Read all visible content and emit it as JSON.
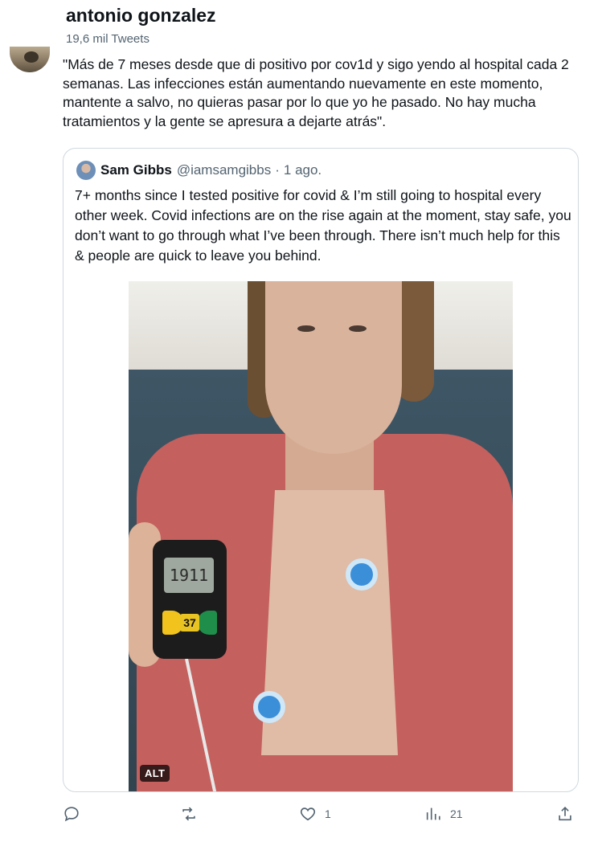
{
  "header": {
    "display_name": "antonio gonzalez",
    "tweet_count": "19,6 mil Tweets"
  },
  "tweet": {
    "text": "\"Más de 7 meses desde que di positivo por cov1d y sigo yendo al hospital cada 2 semanas. Las infecciones están aumentando nuevamente en este momento, mantente a salvo, no quieras pasar por lo que yo he pasado. No hay mucha tratamientos y la gente se apresura a dejarte atrás\"."
  },
  "quote": {
    "name": "Sam Gibbs",
    "handle": "@iamsamgibbs",
    "separator": "·",
    "time": "1 ago.",
    "text": "7+ months since I tested positive for covid & I’m still going to hospital every other week. Covid infections are on the rise again at the moment, stay safe, you don’t want to go through what I’ve been through. There isn’t much help for this & people are quick to leave you behind.",
    "image": {
      "alt_label": "ALT",
      "device_screen": "1911",
      "device_badge": "37"
    }
  },
  "actions": {
    "reply": {
      "icon": "reply-icon",
      "count": ""
    },
    "retweet": {
      "icon": "retweet-icon",
      "count": ""
    },
    "like": {
      "icon": "heart-icon",
      "count": "1"
    },
    "views": {
      "icon": "views-icon",
      "count": "21"
    },
    "share": {
      "icon": "share-icon",
      "count": ""
    }
  },
  "colors": {
    "text_primary": "#0f1419",
    "text_secondary": "#536471",
    "border": "#cfd9de"
  }
}
